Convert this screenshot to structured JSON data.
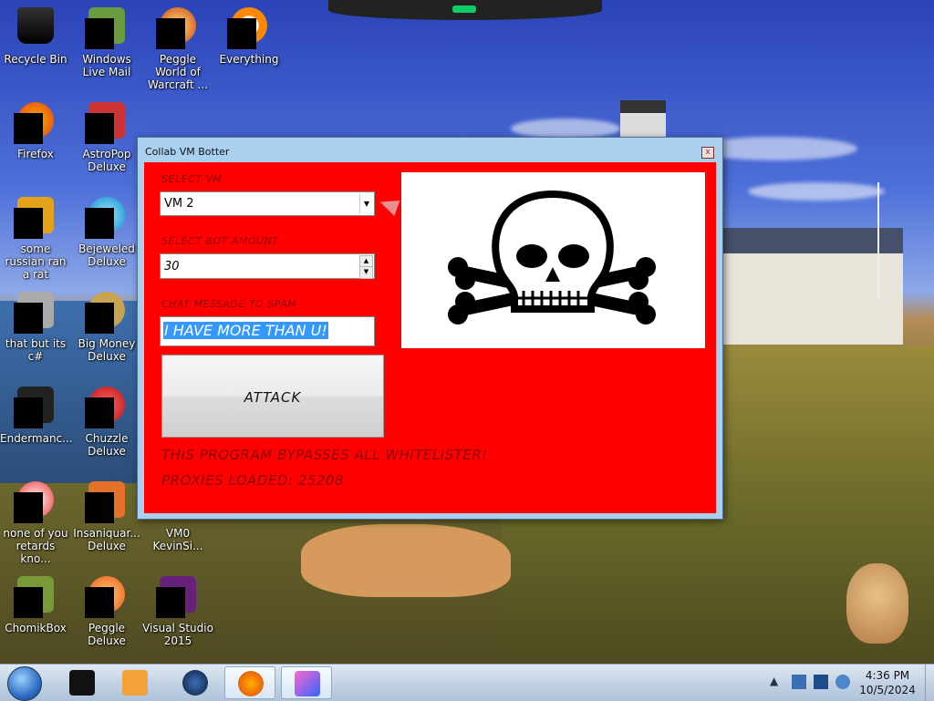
{
  "desktop": {
    "icons": [
      {
        "label": "Recycle Bin"
      },
      {
        "label": "Windows Live Mail"
      },
      {
        "label": "Peggle World of Warcraft ..."
      },
      {
        "label": "Everything"
      },
      {
        "label": "Firefox"
      },
      {
        "label": "AstroPop Deluxe"
      },
      {
        "label": "some russian ran a rat"
      },
      {
        "label": "Bejeweled Deluxe"
      },
      {
        "label": "that but its c#"
      },
      {
        "label": "Big Money Deluxe"
      },
      {
        "label": "Endermanc..."
      },
      {
        "label": "Chuzzle Deluxe"
      },
      {
        "label": "none of you retards kno..."
      },
      {
        "label": "Insaniquar... Deluxe"
      },
      {
        "label": "VM0 KevinSi..."
      },
      {
        "label": "ChomikBox"
      },
      {
        "label": "Peggle Deluxe"
      },
      {
        "label": "Visual Studio 2015"
      }
    ]
  },
  "window": {
    "title": "Collab VM Botter",
    "close_glyph": "x",
    "select_vm_label": "SELECT VM",
    "selected_vm": "VM 2",
    "bot_amount_label": "SELECT BOT AMOUNT",
    "bot_amount": "30",
    "chat_label": "CHAT MESSAGE TO SPAM",
    "chat_message": "I HAVE MORE THAN U!",
    "attack_label": "ATTACK",
    "bypass_message": "THIS PROGRAM BYPASSES ALL WHITELISTER!",
    "proxies_message": "PROXIES LOADED: 25208",
    "accent_color": "#ff0000"
  },
  "taskbar": {
    "pinned": [
      {
        "icon": "black-box-icon"
      },
      {
        "icon": "media-player-icon"
      },
      {
        "icon": "globe-icon"
      },
      {
        "icon": "firefox-icon"
      },
      {
        "icon": "app-icon"
      }
    ],
    "clock_time": "4:36 PM",
    "clock_date": "10/5/2024",
    "tray_arrow": "▲"
  }
}
